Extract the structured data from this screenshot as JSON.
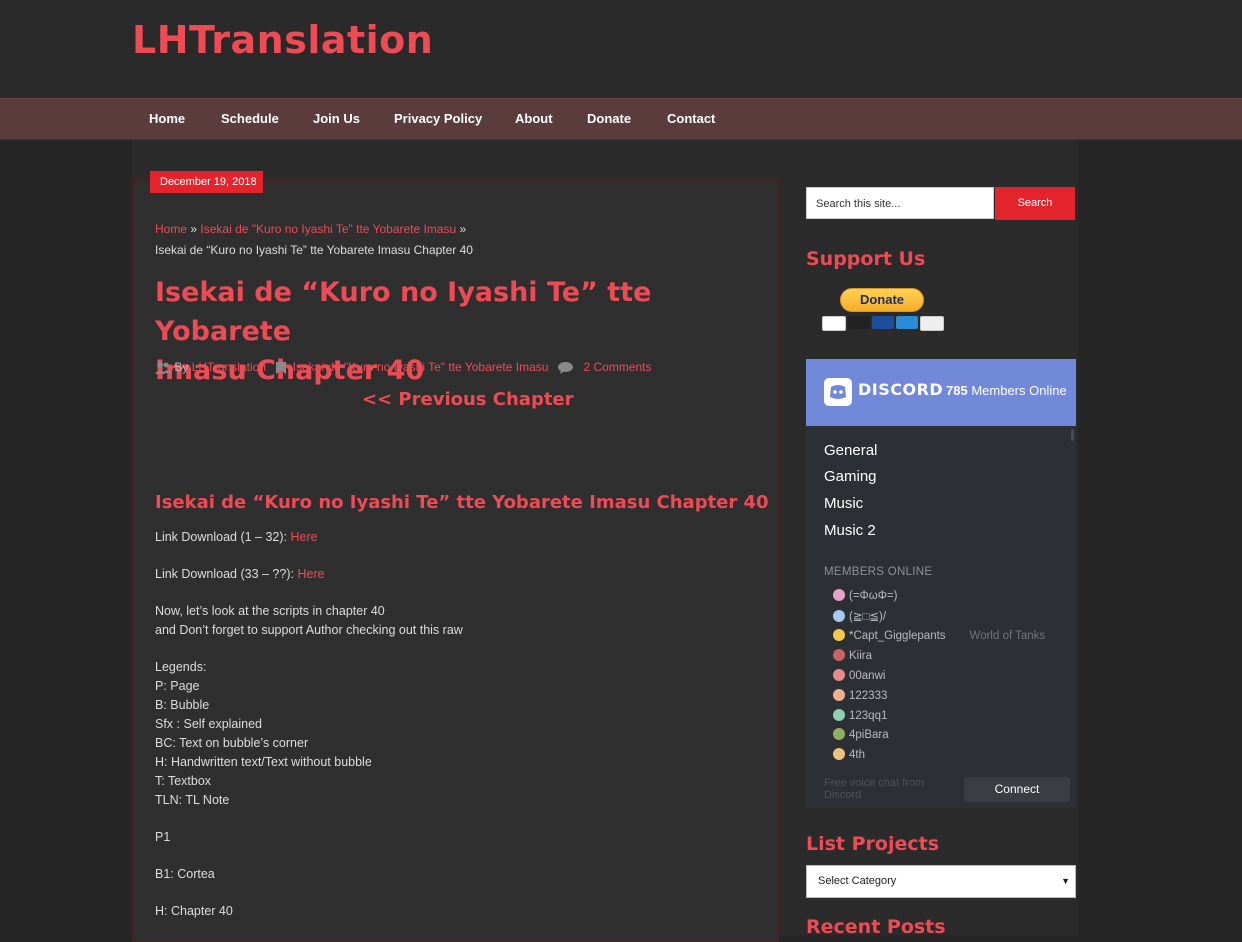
{
  "site": {
    "title": "LHTranslation"
  },
  "nav": [
    "Home",
    "Schedule",
    "Join Us",
    "Privacy Policy",
    "About",
    "Donate",
    "Contact"
  ],
  "post": {
    "date": "December 19, 2018",
    "breadcrumb": {
      "home": "Home",
      "category": "Isekai de \"Kuro no Iyashi Te\" tte Yobarete Imasu",
      "current": "Isekai de “Kuro no Iyashi Te” tte Yobarete Imasu Chapter 40"
    },
    "title_line1": "Isekai de “Kuro no Iyashi Te” tte Yobarete",
    "title_line2": "Imasu Chapter 40",
    "meta": {
      "by": "By",
      "author": "LHTranslation",
      "category": "Isekai de \"Kuro no Iyashi Te\" tte Yobarete Imasu",
      "comments": "2 Comments"
    },
    "prev_chapter": "<< Previous Chapter",
    "content_heading": "Isekai de “Kuro no Iyashi Te” tte Yobarete Imasu Chapter 40",
    "link1_label": "Link Download (1 – 32):",
    "link1_text": "Here",
    "link2_label": "Link Download (33 – ??):",
    "link2_text": "Here",
    "intro1": "Now, let’s look at the scripts in chapter 40",
    "intro2": "and Don’t forget to support Author checking out this raw",
    "legends": [
      "Legends:",
      "P: Page",
      "B: Bubble",
      "Sfx : Self explained",
      "BC: Text on bubble’s corner",
      "H: Handwritten text/Text without bubble",
      "T: Textbox",
      "TLN: TL Note"
    ],
    "p1": "P1",
    "b1": "B1: Cortea",
    "h": "H: Chapter 40"
  },
  "sidebar": {
    "search_placeholder": "Search this site...",
    "search_button": "Search",
    "support_title": "Support Us",
    "donate_button": "Donate",
    "list_projects_title": "List Projects",
    "select_category": "Select Category",
    "recent_posts_title": "Recent Posts"
  },
  "discord": {
    "logo": "DISCORD",
    "members_count": "785",
    "members_label": "Members Online",
    "channels": [
      "General",
      "Gaming",
      "Music",
      "Music 2"
    ],
    "members_online_label": "MEMBERS ONLINE",
    "members": [
      {
        "name": "(=ΦωΦ=)",
        "game": "",
        "color": "#e8a0c8"
      },
      {
        "name": "(≧□≦)/",
        "game": "",
        "color": "#a8c8f0"
      },
      {
        "name": "*Capt_Gigglepants",
        "game": "World of Tanks",
        "color": "#f2c94c"
      },
      {
        "name": "Kiira",
        "game": "",
        "color": "#c86464"
      },
      {
        "name": "00anwi",
        "game": "",
        "color": "#e88a8a"
      },
      {
        "name": "122333",
        "game": "",
        "color": "#f0b090"
      },
      {
        "name": "123qq1",
        "game": "",
        "color": "#8fd0b0"
      },
      {
        "name": "4piBara",
        "game": "",
        "color": "#90b060"
      },
      {
        "name": "4th",
        "game": "",
        "color": "#f0c080"
      }
    ],
    "footer_text": "Free voice chat from Discord",
    "connect_button": "Connect"
  },
  "colors": {
    "accent": "#ee4b55",
    "nav_bg": "#5a3c3d",
    "discord_blurple": "#7289da"
  }
}
